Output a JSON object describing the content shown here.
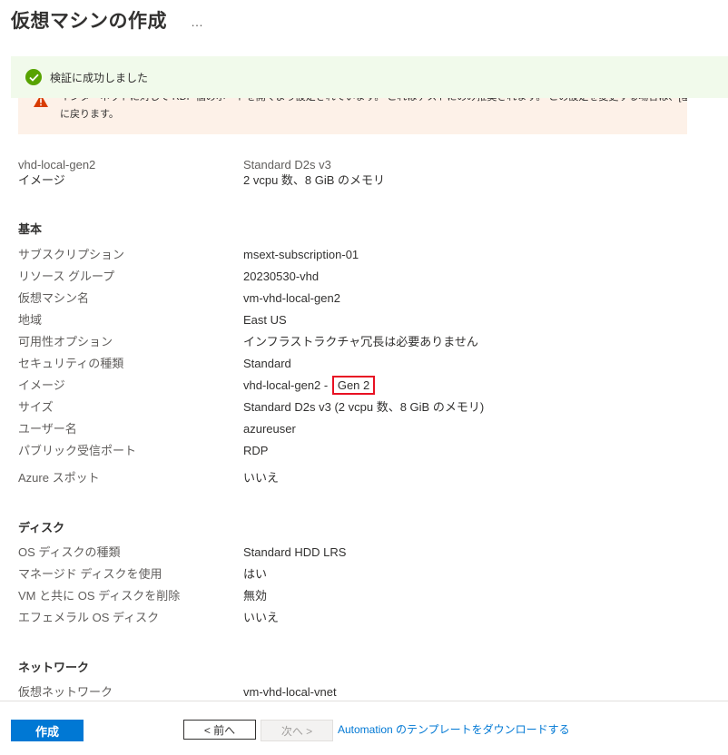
{
  "header": {
    "title": "仮想マシンの作成",
    "more": "…"
  },
  "success": {
    "message": "検証に成功しました"
  },
  "warning": {
    "line1": "インターネットに対して RDP 個のポートを開くよう設定されています。 これはテストにのみ推奨されます。 この設定を変更する場合は、[基本] タブ",
    "line2": "に戻ります。"
  },
  "summary": [
    {
      "label": "vhd-local-gen2",
      "value": "Standard D2s v3"
    },
    {
      "label": "イメージ",
      "value": "2 vcpu 数、8 GiB のメモリ"
    }
  ],
  "basics": {
    "title": "基本",
    "rows": [
      {
        "label": "サブスクリプション",
        "value": "msext-subscription-01"
      },
      {
        "label": "リソース グループ",
        "value": "20230530-vhd"
      },
      {
        "label": "仮想マシン名",
        "value": "vm-vhd-local-gen2"
      },
      {
        "label": "地域",
        "value": "East US"
      },
      {
        "label": "可用性オプション",
        "value": "インフラストラクチャ冗長は必要ありません"
      },
      {
        "label": "セキュリティの種類",
        "value": "Standard"
      },
      {
        "label": "イメージ",
        "value_prefix": "vhd-local-gen2 - ",
        "value_highlight": "Gen 2"
      },
      {
        "label": "サイズ",
        "value": "Standard D2s v3 (2 vcpu 数、8 GiB のメモリ)"
      },
      {
        "label": "ユーザー名",
        "value": "azureuser"
      },
      {
        "label": "パブリック受信ポート",
        "value": "RDP"
      },
      {
        "label": "Azure スポット",
        "value": "いいえ"
      }
    ]
  },
  "disks": {
    "title": "ディスク",
    "rows": [
      {
        "label": "OS ディスクの種類",
        "value": "Standard HDD LRS"
      },
      {
        "label": "マネージド ディスクを使用",
        "value": "はい"
      },
      {
        "label": "VM と共に OS ディスクを削除",
        "value": "無効"
      },
      {
        "label": "エフェメラル OS ディスク",
        "value": "いいえ"
      }
    ]
  },
  "network": {
    "title": "ネットワーク",
    "rows": [
      {
        "label": "仮想ネットワーク",
        "value": "vm-vhd-local-vnet"
      }
    ]
  },
  "footer": {
    "create_label": "作成",
    "prev_label": "< 前へ",
    "next_label": "次へ >",
    "download_label": "Automation のテンプレートをダウンロードする"
  },
  "colors": {
    "primary": "#0078d4",
    "success": "#57a300",
    "warning": "#d83b01",
    "highlight": "#e81123"
  }
}
